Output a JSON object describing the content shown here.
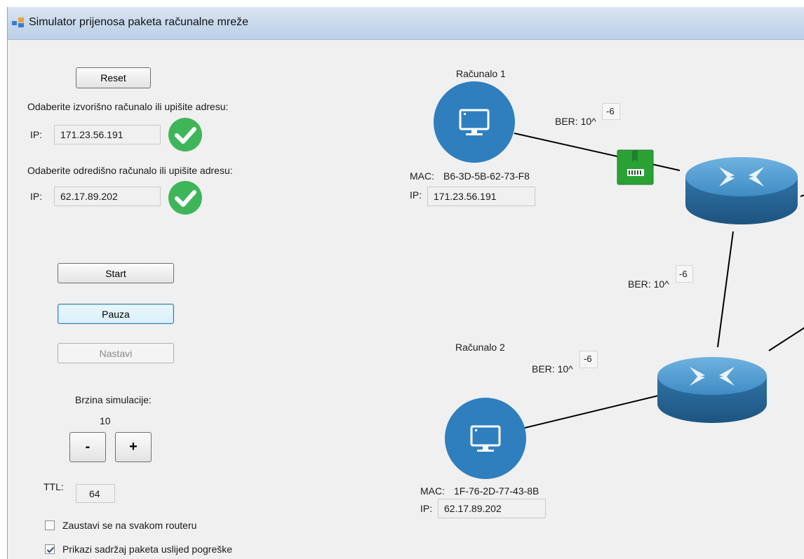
{
  "window": {
    "title": "Simulator prijenosa paketa računalne mreže"
  },
  "controls": {
    "reset_label": "Reset",
    "source_prompt": "Odaberite izvorišno računalo ili upišite adresu:",
    "source_ip_label": "IP:",
    "source_ip_value": "171.23.56.191",
    "dest_prompt": "Odaberite odredišno računalo ili upišite adresu:",
    "dest_ip_label": "IP:",
    "dest_ip_value": "62.17.89.202",
    "start_label": "Start",
    "pause_label": "Pauza",
    "continue_label": "Nastavi",
    "speed_label": "Brzina simulacije:",
    "speed_value": "10",
    "minus_label": "-",
    "plus_label": "+",
    "ttl_label": "TTL:",
    "ttl_value": "64",
    "stop_each_router_label": "Zaustavi se na svakom routeru",
    "stop_each_router_checked": false,
    "show_packet_label": "Prikazi sadržaj paketa uslijed pogreške",
    "show_packet_checked": true
  },
  "network": {
    "computer1": {
      "name": "Računalo 1",
      "mac_label": "MAC:",
      "mac": "B6-3D-5B-62-73-F8",
      "ip_label": "IP:",
      "ip": "171.23.56.191"
    },
    "computer2": {
      "name": "Računalo 2",
      "mac_label": "MAC:",
      "mac": "1F-76-2D-77-43-8B",
      "ip_label": "IP:",
      "ip": "62.17.89.202"
    },
    "links": [
      {
        "ber_text": "BER: 10^",
        "exp": "-6"
      },
      {
        "ber_text": "BER: 10^",
        "exp": "-6"
      },
      {
        "ber_text": "BER: 10^",
        "exp": "-6"
      }
    ],
    "colors": {
      "node_blue": "#2f7fbf",
      "router_blue": "#3b86b8",
      "packet_green": "#2aa135",
      "ok_green": "#3fb55a"
    },
    "icons": [
      "monitor-icon",
      "router-icon",
      "packet-icon",
      "checkmark-icon"
    ]
  }
}
